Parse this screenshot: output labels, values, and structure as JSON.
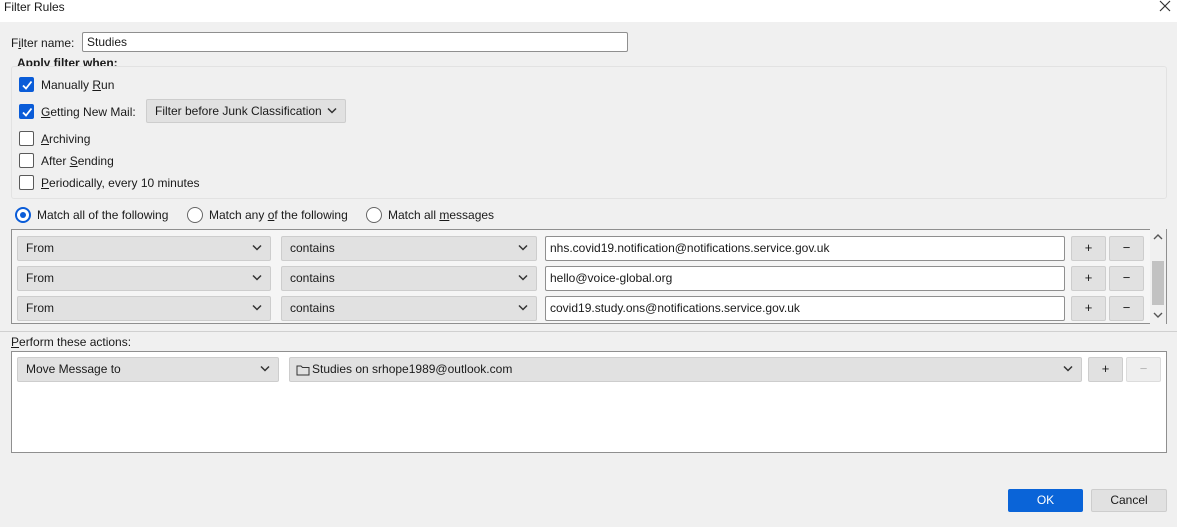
{
  "window": {
    "title": "Filter Rules"
  },
  "filter_name": {
    "label_pre": "F",
    "label_u": "i",
    "label_post": "lter name:",
    "value": "Studies"
  },
  "apply_when": {
    "label": "Apply filter when:",
    "manually_run": {
      "pre": "Manually ",
      "u": "R",
      "post": "un",
      "checked": true
    },
    "getting_new_mail": {
      "pre": "",
      "u": "G",
      "post": "etting New Mail:",
      "checked": true,
      "option": "Filter before Junk Classification"
    },
    "archiving": {
      "pre": "",
      "u": "A",
      "post": "rchiving",
      "checked": false
    },
    "after_sending": {
      "pre": "After ",
      "u": "S",
      "post": "ending",
      "checked": false
    },
    "periodically": {
      "pre": "",
      "u": "P",
      "post": "eriodically, every 10 minutes",
      "checked": false
    }
  },
  "match": {
    "all": {
      "pre": "Match all of the following",
      "u": "",
      "post": "",
      "selected": true
    },
    "any": {
      "pre": "Match any ",
      "u": "o",
      "post": "f the following",
      "selected": false
    },
    "messages": {
      "pre": "Match all ",
      "u": "m",
      "post": "essages",
      "selected": false
    }
  },
  "rules": [
    {
      "field": "From",
      "operator": "contains",
      "value": "nhs.covid19.notification@notifications.service.gov.uk"
    },
    {
      "field": "From",
      "operator": "contains",
      "value": "hello@voice-global.org"
    },
    {
      "field": "From",
      "operator": "contains",
      "value": "covid19.study.ons@notifications.service.gov.uk"
    }
  ],
  "rule_buttons": {
    "add": "+",
    "remove": "−"
  },
  "actions": {
    "label_u": "P",
    "label_post": "erform these actions:",
    "action": "Move Message to",
    "target": "Studies on srhope1989@outlook.com",
    "add": "+",
    "remove": "−"
  },
  "buttons": {
    "ok": "OK",
    "cancel": "Cancel"
  },
  "colors": {
    "accent": "#0a5cd8",
    "ok_button": "#0a64d8"
  }
}
